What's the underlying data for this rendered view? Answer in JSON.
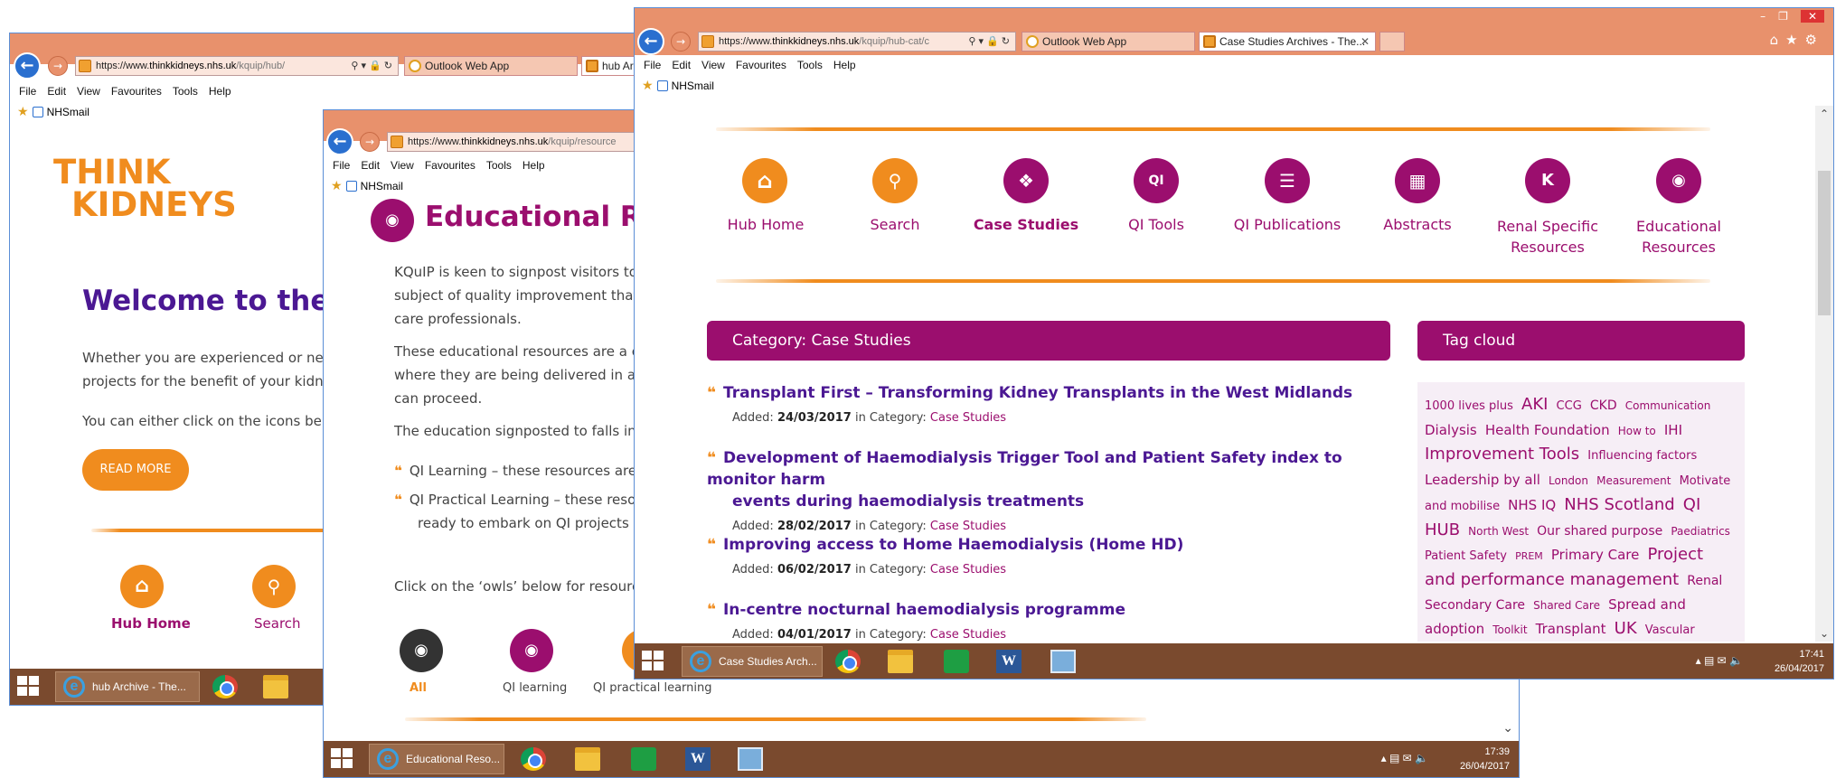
{
  "window1": {
    "url_scheme": "https://www.",
    "url_host": "thinkkidneys.nhs.uk",
    "url_path": "/kquip/hub/",
    "tabs": [
      "Outlook Web App",
      "hub Arch"
    ],
    "menu": [
      "File",
      "Edit",
      "View",
      "Favourites",
      "Tools",
      "Help"
    ],
    "fav_label": "NHSmail",
    "logo_line1": "THINK",
    "logo_line2": "KIDNEYS",
    "welcome": "Welcome to the K",
    "para1_line1": "Whether you are experienced or new",
    "para1_line2": "projects for the benefit of your kidne",
    "para2": "You can either click on the icons belo",
    "read_more": "READ MORE",
    "nav": [
      "Hub Home",
      "Search"
    ],
    "taskbar_item": "hub Archive - The..."
  },
  "window2": {
    "url_scheme": "https://www.",
    "url_host": "thinkkidneys.nhs.uk",
    "url_path": "/kquip/resource",
    "menu": [
      "File",
      "Edit",
      "View",
      "Favourites",
      "Tools",
      "Help"
    ],
    "fav_label": "NHSmail",
    "heading": "Educational Res",
    "p1": [
      "KQuIP is keen to signpost visitors to t",
      "subject of quality improvement that l",
      "care professionals."
    ],
    "p2": [
      "These educational resources are a co",
      "where they are being delivered in a g",
      "can proceed."
    ],
    "p3": "The education signposted to falls into",
    "bullet1": "QI Learning – these resources are",
    "bullet2_line1": "QI Practical Learning – these reso",
    "bullet2_line2": "ready to embark on QI projects",
    "p4": "Click on the ‘owls’ below for resource",
    "owls": [
      "All",
      "QI learning",
      "QI practical learning"
    ],
    "taskbar_item": "Educational Reso...",
    "clock_time": "17:39",
    "clock_date": "26/04/2017"
  },
  "window3": {
    "url_scheme": "https://www.",
    "url_host": "thinkkidneys.nhs.uk",
    "url_path": "/kquip/hub-cat/c",
    "tabs": [
      "Outlook Web App",
      "Case Studies Archives - The..."
    ],
    "menu": [
      "File",
      "Edit",
      "View",
      "Favourites",
      "Tools",
      "Help"
    ],
    "fav_label": "NHSmail",
    "nav": [
      {
        "label": "Hub Home",
        "icon": "home-icon",
        "color": "#f08c1e"
      },
      {
        "label": "Search",
        "icon": "search-icon",
        "color": "#f08c1e"
      },
      {
        "label": "Case Studies",
        "icon": "case-studies-icon",
        "color": "#9b0e6e"
      },
      {
        "label": "QI Tools",
        "icon": "qi-tools-icon",
        "color": "#9b0e6e"
      },
      {
        "label": "QI Publications",
        "icon": "publications-icon",
        "color": "#9b0e6e"
      },
      {
        "label": "Abstracts",
        "icon": "abstracts-icon",
        "color": "#9b0e6e"
      },
      {
        "label": "Renal Specific",
        "label2": "Resources",
        "icon": "renal-icon",
        "color": "#9b0e6e"
      },
      {
        "label": "Educational",
        "label2": "Resources",
        "icon": "owl-icon",
        "color": "#9b0e6e"
      }
    ],
    "category_heading": "Category: Case Studies",
    "tag_heading": "Tag cloud",
    "added_label": "Added:",
    "in_category": "in Category:",
    "category_link": "Case Studies",
    "articles": [
      {
        "title": "Transplant First – Transforming Kidney Transplants in the West Midlands",
        "date": "24/03/2017"
      },
      {
        "title": "Development of Haemodialysis Trigger Tool and Patient Safety index to monitor harm",
        "title2": "events during haemodialysis treatments",
        "date": "28/02/2017"
      },
      {
        "title": "Improving access to Home Haemodialysis (Home HD)",
        "date": "06/02/2017"
      },
      {
        "title": "In-centre nocturnal haemodialysis programme",
        "date": "04/01/2017"
      }
    ],
    "tags": [
      {
        "t": "1000 lives plus",
        "s": 13
      },
      {
        "t": "AKI",
        "s": 18
      },
      {
        "t": "CCG",
        "s": 13
      },
      {
        "t": "CKD",
        "s": 14
      },
      {
        "t": "Communication",
        "s": 12
      },
      {
        "t": "Dialysis",
        "s": 15
      },
      {
        "t": "Health Foundation",
        "s": 15
      },
      {
        "t": "How to",
        "s": 12
      },
      {
        "t": "IHI",
        "s": 15
      },
      {
        "t": "Improvement Tools",
        "s": 18
      },
      {
        "t": "Influencing factors",
        "s": 13
      },
      {
        "t": "Leadership by all",
        "s": 15
      },
      {
        "t": "London",
        "s": 12
      },
      {
        "t": "Measurement",
        "s": 12
      },
      {
        "t": "Motivate and mobilise",
        "s": 13
      },
      {
        "t": "NHS IQ",
        "s": 15
      },
      {
        "t": "NHS Scotland",
        "s": 18
      },
      {
        "t": "QI HUB",
        "s": 18
      },
      {
        "t": "North West",
        "s": 12
      },
      {
        "t": "Our shared purpose",
        "s": 14
      },
      {
        "t": "Paediatrics",
        "s": 12
      },
      {
        "t": "Patient Safety",
        "s": 13
      },
      {
        "t": "PREM",
        "s": 11
      },
      {
        "t": "Primary Care",
        "s": 15
      },
      {
        "t": "Project and performance management",
        "s": 18
      },
      {
        "t": "Renal Secondary Care",
        "s": 14
      },
      {
        "t": "Shared Care",
        "s": 12
      },
      {
        "t": "Spread and adoption",
        "s": 15
      },
      {
        "t": "Toolkit",
        "s": 12
      },
      {
        "t": "Transplant",
        "s": 15
      },
      {
        "t": "UK",
        "s": 18
      },
      {
        "t": "Vascular",
        "s": 13
      }
    ],
    "taskbar_item": "Case Studies Arch...",
    "clock_time": "17:41",
    "clock_date": "26/04/2017"
  }
}
